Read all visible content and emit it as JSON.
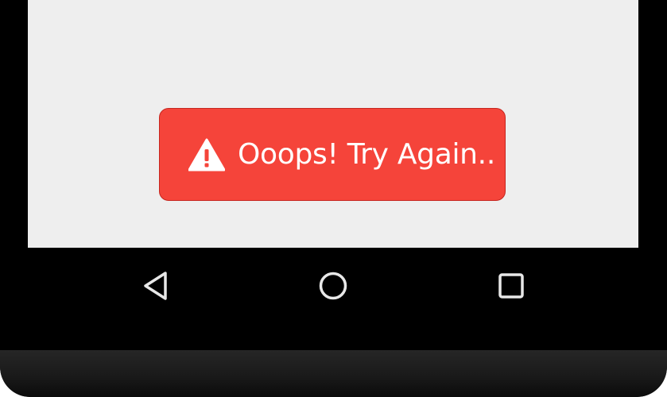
{
  "error_toast": {
    "message": "Ooops! Try Again..",
    "icon": "warning-icon",
    "background_color": "#f5443a",
    "text_color": "#ffffff"
  },
  "screen": {
    "background_color": "#eeeeee"
  },
  "navbar": {
    "buttons": [
      {
        "name": "back",
        "icon": "triangle-back-icon"
      },
      {
        "name": "home",
        "icon": "circle-home-icon"
      },
      {
        "name": "recents",
        "icon": "square-recents-icon"
      }
    ]
  }
}
